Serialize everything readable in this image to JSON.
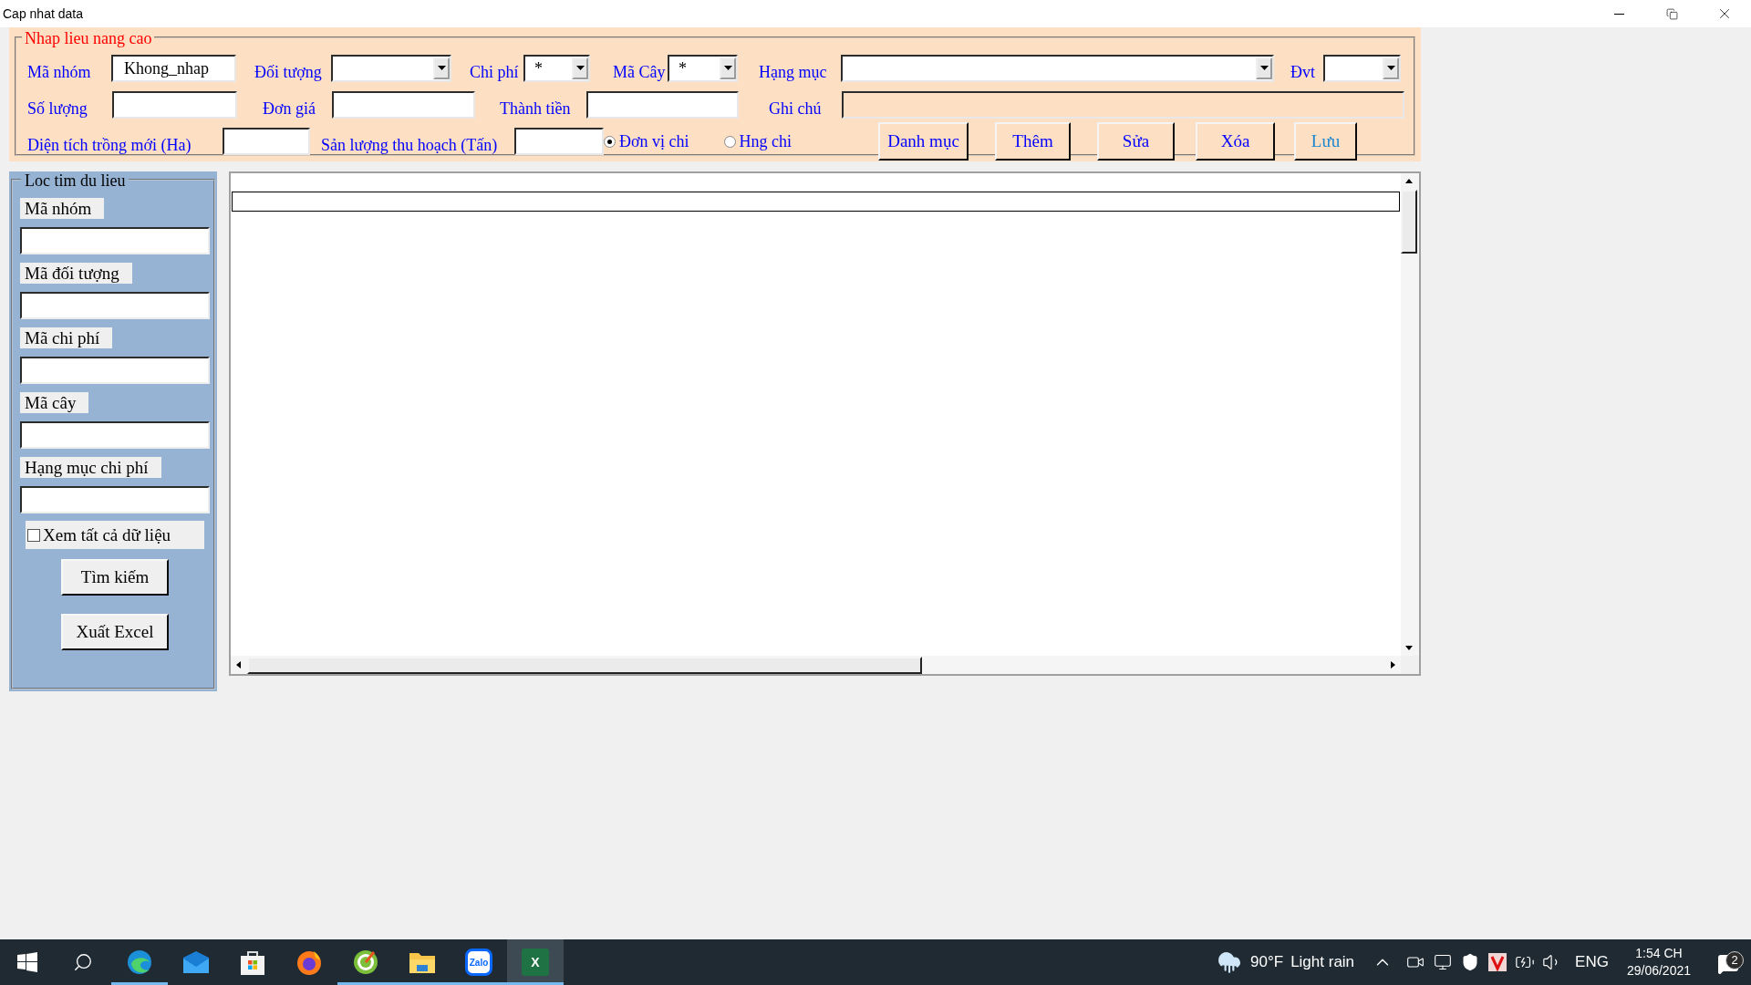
{
  "window": {
    "title": "Cap nhat data"
  },
  "entry_panel": {
    "title": "Nhap lieu nang cao",
    "fields": [
      {
        "label": "Mã nhóm",
        "kind": "text",
        "value": "Khong_nhap"
      },
      {
        "label": "Đối tượng",
        "kind": "combo"
      },
      {
        "label": "Chi phí",
        "kind": "combo",
        "value": "*"
      },
      {
        "label": "Mã Cây",
        "kind": "combo",
        "value": "*"
      },
      {
        "label": "Hạng mục",
        "kind": "combo"
      },
      {
        "label": "Đvt",
        "kind": "combo"
      },
      {
        "label": "Số lượng",
        "kind": "text"
      },
      {
        "label": "Đơn giá",
        "kind": "text"
      },
      {
        "label": "Thành tiền",
        "kind": "text"
      },
      {
        "label": "Ghi chú",
        "kind": "text",
        "disabled": true
      },
      {
        "label": "Diện tích trồng mới (Ha)",
        "kind": "text"
      },
      {
        "label": "Sản lượng thu hoạch (Tấn)",
        "kind": "text"
      }
    ],
    "radios": [
      {
        "label": "Đơn vị chi",
        "selected": true
      },
      {
        "label": "Hng chi",
        "selected": false
      }
    ],
    "buttons": [
      {
        "label": "Danh mục",
        "color": "#0000ff"
      },
      {
        "label": "Thêm",
        "color": "#0000ff"
      },
      {
        "label": "Sửa",
        "color": "#0000ff"
      },
      {
        "label": "Xóa",
        "color": "#0000ff"
      },
      {
        "label": "Lưu",
        "color": "#1a86d0"
      }
    ]
  },
  "filter_panel": {
    "title": "Loc tim du lieu",
    "fields": [
      {
        "label": "Mã nhóm"
      },
      {
        "label": "Mã đối tượng"
      },
      {
        "label": "Mã chi phí"
      },
      {
        "label": "Mã cây"
      },
      {
        "label": "Hạng mục chi phí"
      }
    ],
    "show_all": {
      "label": "Xem tất cả dữ liệu",
      "checked": false
    },
    "buttons": [
      "Tìm kiếm",
      "Xuất Excel"
    ]
  },
  "taskbar": {
    "apps": [
      {
        "kind": "edge",
        "running": true
      },
      {
        "kind": "mail",
        "running": false
      },
      {
        "kind": "store",
        "running": false
      },
      {
        "kind": "firefox",
        "running": false
      },
      {
        "kind": "coccoc",
        "running": true
      },
      {
        "kind": "explorer",
        "running": true
      },
      {
        "kind": "zalo",
        "running": true,
        "text": "Zalo"
      },
      {
        "kind": "excel",
        "running": true,
        "active": true,
        "text": "X"
      }
    ],
    "weather": {
      "temperature": "90°F",
      "condition": "Light rain"
    },
    "language": "ENG",
    "time": "1:54 CH",
    "date": "29/06/2021",
    "notifications": "2"
  }
}
